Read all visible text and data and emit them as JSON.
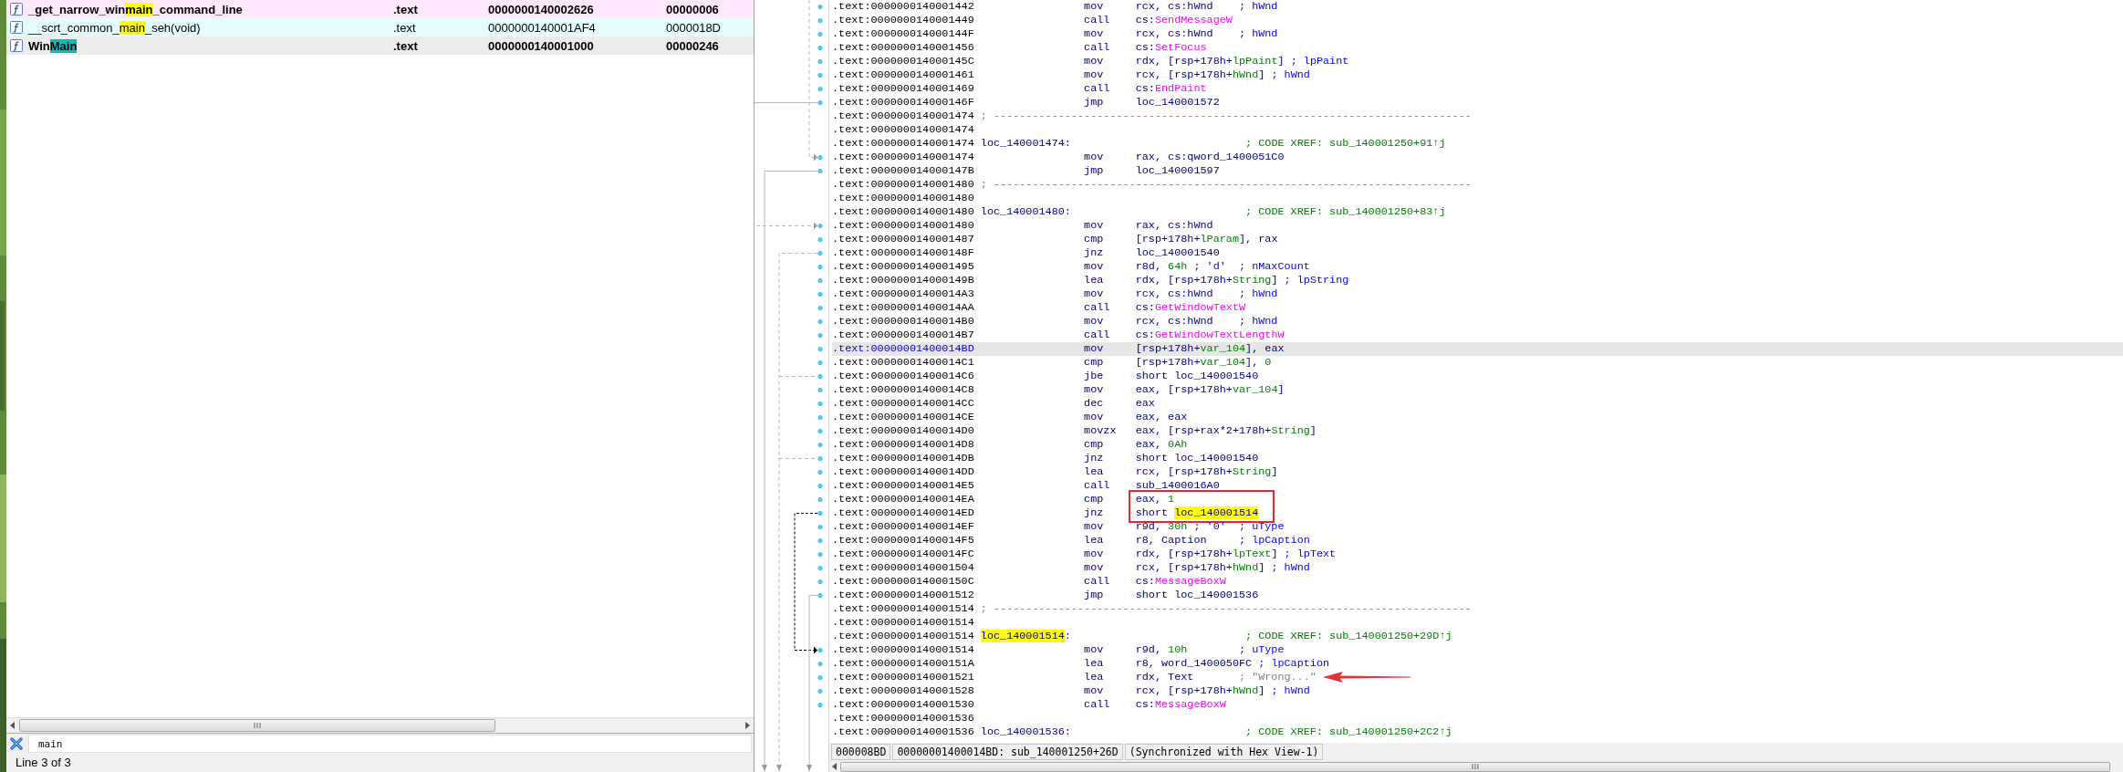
{
  "functions": {
    "rows": [
      {
        "name_before": "_get_narrow_win",
        "match": "main",
        "name_after": "_command_line",
        "segment": ".text",
        "start": "0000000140002626",
        "length": "00000006",
        "bold": true,
        "color": "#ffe8fb",
        "selected": false
      },
      {
        "name_before": "__scrt_common_",
        "match": "main",
        "name_after": "_seh(void)",
        "segment": ".text",
        "start": "0000000140001AF4",
        "length": "0000018D",
        "bold": false,
        "color": "#e6fdfd",
        "selected": false
      },
      {
        "name_before": "Win",
        "match": "Main",
        "name_after": "",
        "segment": ".text",
        "start": "0000000140001000",
        "length": "00000246",
        "bold": true,
        "selected": true
      }
    ],
    "filter": {
      "value": "main"
    },
    "status": "Line 3 of 3"
  },
  "disassembly": {
    "rows": [
      {
        "kind": "ins",
        "selected": false,
        "addr": ".text:0000000140001442",
        "mnem": "mov",
        "ops": [
          {
            "text": "rcx, cs:hWnd"
          }
        ],
        "cmt": {
          "text": "; hWnd",
          "kind": "name"
        }
      },
      {
        "kind": "ins",
        "selected": false,
        "addr": ".text:0000000140001449",
        "mnem": "call",
        "ops": [
          {
            "text": "cs:"
          },
          {
            "text": "SendMessageW",
            "kind": "import"
          }
        ]
      },
      {
        "kind": "ins",
        "selected": false,
        "addr": ".text:000000014000144F",
        "mnem": "mov",
        "ops": [
          {
            "text": "rcx, cs:hWnd"
          }
        ],
        "cmt": {
          "text": "; hWnd",
          "kind": "name"
        }
      },
      {
        "kind": "ins",
        "selected": false,
        "addr": ".text:0000000140001456",
        "mnem": "call",
        "ops": [
          {
            "text": "cs:"
          },
          {
            "text": "SetFocus",
            "kind": "import"
          }
        ]
      },
      {
        "kind": "ins",
        "selected": false,
        "addr": ".text:000000014000145C",
        "mnem": "mov",
        "ops": [
          {
            "text": "rdx, [rsp+178h+"
          },
          {
            "text": "lpPaint",
            "kind": "var"
          },
          {
            "text": "]"
          }
        ],
        "cmt": {
          "text": "; lpPaint",
          "kind": "name"
        }
      },
      {
        "kind": "ins",
        "selected": false,
        "addr": ".text:0000000140001461",
        "mnem": "mov",
        "ops": [
          {
            "text": "rcx, [rsp+178h+"
          },
          {
            "text": "hWnd",
            "kind": "var"
          },
          {
            "text": "]"
          }
        ],
        "cmt": {
          "text": "; hWnd",
          "kind": "name"
        }
      },
      {
        "kind": "ins",
        "selected": false,
        "addr": ".text:0000000140001469",
        "mnem": "call",
        "ops": [
          {
            "text": "cs:"
          },
          {
            "text": "EndPaint",
            "kind": "import"
          }
        ]
      },
      {
        "kind": "ins",
        "selected": false,
        "addr": ".text:000000014000146F",
        "mnem": "jmp",
        "ops": [
          {
            "text": "loc_140001572"
          }
        ]
      },
      {
        "kind": "separator",
        "selected": false,
        "addr": ".text:0000000140001474",
        "text": "; --------------------------------------------------------------------------"
      },
      {
        "kind": "blank",
        "selected": false,
        "addr": ".text:0000000140001474"
      },
      {
        "kind": "label",
        "selected": false,
        "addr": ".text:0000000140001474",
        "label": [
          {
            "text": "loc_140001474:"
          }
        ],
        "cmt": {
          "text": "; CODE XREF: sub_140001250+91↑j",
          "kind": "xref"
        }
      },
      {
        "kind": "ins",
        "selected": false,
        "addr": ".text:0000000140001474",
        "mnem": "mov",
        "ops": [
          {
            "text": "rax, cs:qword_1400051C0"
          }
        ]
      },
      {
        "kind": "ins",
        "selected": false,
        "addr": ".text:000000014000147B",
        "mnem": "jmp",
        "ops": [
          {
            "text": "loc_140001597"
          }
        ]
      },
      {
        "kind": "separator",
        "selected": false,
        "addr": ".text:0000000140001480",
        "text": "; --------------------------------------------------------------------------"
      },
      {
        "kind": "blank",
        "selected": false,
        "addr": ".text:0000000140001480"
      },
      {
        "kind": "label",
        "selected": false,
        "addr": ".text:0000000140001480",
        "label": [
          {
            "text": "loc_140001480:"
          }
        ],
        "cmt": {
          "text": "; CODE XREF: sub_140001250+83↑j",
          "kind": "xref"
        }
      },
      {
        "kind": "ins",
        "selected": false,
        "addr": ".text:0000000140001480",
        "mnem": "mov",
        "ops": [
          {
            "text": "rax, cs:hWnd"
          }
        ]
      },
      {
        "kind": "ins",
        "selected": false,
        "addr": ".text:0000000140001487",
        "mnem": "cmp",
        "ops": [
          {
            "text": "[rsp+178h+"
          },
          {
            "text": "lParam",
            "kind": "var"
          },
          {
            "text": "], rax"
          }
        ]
      },
      {
        "kind": "ins",
        "selected": false,
        "addr": ".text:000000014000148F",
        "mnem": "jnz",
        "ops": [
          {
            "text": "loc_140001540"
          }
        ]
      },
      {
        "kind": "ins",
        "selected": false,
        "addr": ".text:0000000140001495",
        "mnem": "mov",
        "ops": [
          {
            "text": "r8d, "
          },
          {
            "text": "64h",
            "kind": "num"
          },
          {
            "text": " ; 'd'",
            "kind": "comment"
          }
        ],
        "cmt": {
          "text": "; nMaxCount",
          "kind": "name"
        }
      },
      {
        "kind": "ins",
        "selected": false,
        "addr": ".text:000000014000149B",
        "mnem": "lea",
        "ops": [
          {
            "text": "rdx, [rsp+178h+"
          },
          {
            "text": "String",
            "kind": "var"
          },
          {
            "text": "]"
          }
        ],
        "cmt": {
          "text": "; lpString",
          "kind": "name"
        }
      },
      {
        "kind": "ins",
        "selected": false,
        "addr": ".text:00000001400014A3",
        "mnem": "mov",
        "ops": [
          {
            "text": "rcx, cs:hWnd"
          }
        ],
        "cmt": {
          "text": "; hWnd",
          "kind": "name"
        }
      },
      {
        "kind": "ins",
        "selected": false,
        "addr": ".text:00000001400014AA",
        "mnem": "call",
        "ops": [
          {
            "text": "cs:"
          },
          {
            "text": "GetWindowTextW",
            "kind": "import"
          }
        ]
      },
      {
        "kind": "ins",
        "selected": false,
        "addr": ".text:00000001400014B0",
        "mnem": "mov",
        "ops": [
          {
            "text": "rcx, cs:hWnd"
          }
        ],
        "cmt": {
          "text": "; hWnd",
          "kind": "name"
        }
      },
      {
        "kind": "ins",
        "selected": false,
        "addr": ".text:00000001400014B7",
        "mnem": "call",
        "ops": [
          {
            "text": "cs:"
          },
          {
            "text": "GetWindowTextLengthW",
            "kind": "import"
          }
        ]
      },
      {
        "kind": "ins",
        "selected": true,
        "addr": ".text:00000001400014BD",
        "mnem": "mov",
        "ops": [
          {
            "text": "[rsp+178h+"
          },
          {
            "text": "var_104",
            "kind": "var"
          },
          {
            "text": "], eax"
          }
        ]
      },
      {
        "kind": "ins",
        "selected": false,
        "addr": ".text:00000001400014C1",
        "mnem": "cmp",
        "ops": [
          {
            "text": "[rsp+178h+"
          },
          {
            "text": "var_104",
            "kind": "var"
          },
          {
            "text": "], "
          },
          {
            "text": "0",
            "kind": "num"
          }
        ]
      },
      {
        "kind": "ins",
        "selected": false,
        "addr": ".text:00000001400014C6",
        "mnem": "jbe",
        "ops": [
          {
            "text": "short loc_140001540"
          }
        ]
      },
      {
        "kind": "ins",
        "selected": false,
        "addr": ".text:00000001400014C8",
        "mnem": "mov",
        "ops": [
          {
            "text": "eax, [rsp+178h+"
          },
          {
            "text": "var_104",
            "kind": "var"
          },
          {
            "text": "]"
          }
        ]
      },
      {
        "kind": "ins",
        "selected": false,
        "addr": ".text:00000001400014CC",
        "mnem": "dec",
        "ops": [
          {
            "text": "eax"
          }
        ]
      },
      {
        "kind": "ins",
        "selected": false,
        "addr": ".text:00000001400014CE",
        "mnem": "mov",
        "ops": [
          {
            "text": "eax, eax"
          }
        ]
      },
      {
        "kind": "ins",
        "selected": false,
        "addr": ".text:00000001400014D0",
        "mnem": "movzx",
        "ops": [
          {
            "text": "eax, [rsp+rax*2+178h+"
          },
          {
            "text": "String",
            "kind": "var"
          },
          {
            "text": "]"
          }
        ]
      },
      {
        "kind": "ins",
        "selected": false,
        "addr": ".text:00000001400014D8",
        "mnem": "cmp",
        "ops": [
          {
            "text": "eax, "
          },
          {
            "text": "0Ah",
            "kind": "num"
          }
        ]
      },
      {
        "kind": "ins",
        "selected": false,
        "addr": ".text:00000001400014DB",
        "mnem": "jnz",
        "ops": [
          {
            "text": "short loc_140001540"
          }
        ]
      },
      {
        "kind": "ins",
        "selected": false,
        "addr": ".text:00000001400014DD",
        "mnem": "lea",
        "ops": [
          {
            "text": "rcx, [rsp+178h+"
          },
          {
            "text": "String",
            "kind": "var"
          },
          {
            "text": "]"
          }
        ]
      },
      {
        "kind": "ins",
        "selected": false,
        "addr": ".text:00000001400014E5",
        "mnem": "call",
        "ops": [
          {
            "text": "sub_1400016A0"
          }
        ]
      },
      {
        "kind": "ins",
        "selected": false,
        "addr": ".text:00000001400014EA",
        "mnem": "cmp",
        "ops": [
          {
            "text": "eax, "
          },
          {
            "text": "1",
            "kind": "num"
          }
        ],
        "boxed": true
      },
      {
        "kind": "ins",
        "selected": false,
        "addr": ".text:00000001400014ED",
        "mnem": "jnz",
        "ops": [
          {
            "text": "short "
          },
          {
            "text": "loc_140001514",
            "kind": "highlight"
          }
        ],
        "boxed": true
      },
      {
        "kind": "ins",
        "selected": false,
        "addr": ".text:00000001400014EF",
        "mnem": "mov",
        "ops": [
          {
            "text": "r9d, "
          },
          {
            "text": "30h",
            "kind": "num"
          },
          {
            "text": " ; '0'",
            "kind": "comment"
          }
        ],
        "cmt": {
          "text": "; uType",
          "kind": "name"
        }
      },
      {
        "kind": "ins",
        "selected": false,
        "addr": ".text:00000001400014F5",
        "mnem": "lea",
        "ops": [
          {
            "text": "r8, Caption"
          }
        ],
        "cmt": {
          "text": "; lpCaption",
          "kind": "name"
        }
      },
      {
        "kind": "ins",
        "selected": false,
        "addr": ".text:00000001400014FC",
        "mnem": "mov",
        "ops": [
          {
            "text": "rdx, [rsp+178h+"
          },
          {
            "text": "lpText",
            "kind": "var"
          },
          {
            "text": "]"
          }
        ],
        "cmt": {
          "text": "; lpText",
          "kind": "name"
        }
      },
      {
        "kind": "ins",
        "selected": false,
        "addr": ".text:0000000140001504",
        "mnem": "mov",
        "ops": [
          {
            "text": "rcx, [rsp+178h+"
          },
          {
            "text": "hWnd",
            "kind": "var"
          },
          {
            "text": "]"
          }
        ],
        "cmt": {
          "text": "; hWnd",
          "kind": "name"
        }
      },
      {
        "kind": "ins",
        "selected": false,
        "addr": ".text:000000014000150C",
        "mnem": "call",
        "ops": [
          {
            "text": "cs:"
          },
          {
            "text": "MessageBoxW",
            "kind": "import"
          }
        ]
      },
      {
        "kind": "ins",
        "selected": false,
        "addr": ".text:0000000140001512",
        "mnem": "jmp",
        "ops": [
          {
            "text": "short loc_140001536"
          }
        ]
      },
      {
        "kind": "separator",
        "selected": false,
        "addr": ".text:0000000140001514",
        "text": "; --------------------------------------------------------------------------"
      },
      {
        "kind": "blank",
        "selected": false,
        "addr": ".text:0000000140001514"
      },
      {
        "kind": "label",
        "selected": false,
        "addr": ".text:0000000140001514",
        "label": [
          {
            "text": "loc_140001514",
            "kind": "highlight"
          },
          {
            "text": ":"
          }
        ],
        "cmt": {
          "text": "; CODE XREF: sub_140001250+29D↑j",
          "kind": "xref"
        }
      },
      {
        "kind": "ins",
        "selected": false,
        "addr": ".text:0000000140001514",
        "mnem": "mov",
        "ops": [
          {
            "text": "r9d, "
          },
          {
            "text": "10h",
            "kind": "num"
          }
        ],
        "cmt": {
          "text": "; uType",
          "kind": "name"
        }
      },
      {
        "kind": "ins",
        "selected": false,
        "addr": ".text:000000014000151A",
        "mnem": "lea",
        "ops": [
          {
            "text": "r8, word_1400050FC"
          }
        ],
        "cmt": {
          "text": "; lpCaption",
          "kind": "name"
        }
      },
      {
        "kind": "ins",
        "selected": false,
        "addr": ".text:0000000140001521",
        "mnem": "lea",
        "ops": [
          {
            "text": "rdx, Text"
          }
        ],
        "cmt": {
          "text": "; \"Wrong...\"",
          "kind": "string"
        },
        "arrow": true
      },
      {
        "kind": "ins",
        "selected": false,
        "addr": ".text:0000000140001528",
        "mnem": "mov",
        "ops": [
          {
            "text": "rcx, [rsp+178h+"
          },
          {
            "text": "hWnd",
            "kind": "var"
          },
          {
            "text": "]"
          }
        ],
        "cmt": {
          "text": "; hWnd",
          "kind": "name"
        }
      },
      {
        "kind": "ins",
        "selected": false,
        "addr": ".text:0000000140001530",
        "mnem": "call",
        "ops": [
          {
            "text": "cs:"
          },
          {
            "text": "MessageBoxW",
            "kind": "import"
          }
        ]
      },
      {
        "kind": "blank",
        "selected": false,
        "addr": ".text:0000000140001536"
      },
      {
        "kind": "label",
        "selected": false,
        "addr": ".text:0000000140001536",
        "label": [
          {
            "text": "loc_140001536:"
          }
        ],
        "cmt": {
          "text": "; CODE XREF: sub_140001250+2C2↑j",
          "kind": "xref"
        }
      }
    ],
    "status": [
      "000008BD",
      "00000001400014BD: sub_140001250+26D",
      "(Synchronized with Hex View-1)"
    ]
  }
}
